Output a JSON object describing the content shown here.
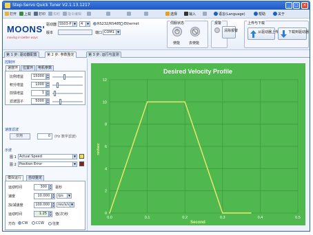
{
  "window": {
    "title": "Step-Servo Quick Tuner V2.1.13.1217"
  },
  "menubar": {
    "items": [
      {
        "label": "打开",
        "icon": "open-icon",
        "color": "#e3b53a"
      },
      {
        "label": "上载",
        "icon": "upload-icon",
        "color": "#3c8a3c"
      },
      {
        "label": "打印",
        "icon": "print-icon",
        "color": "#5a6b8a"
      },
      {
        "label": "实时",
        "icon": "monitor-icon",
        "color": "#6b7d99"
      },
      {
        "label": "指令编辑",
        "icon": "command-editor-icon",
        "color": "#6b7d99"
      },
      {
        "label": "选择",
        "icon": "select-icon",
        "color": "#e6a019"
      },
      {
        "label": "输入",
        "icon": "input-icon",
        "color": "#333333"
      },
      {
        "label": "语言(Language)",
        "icon": "language-icon",
        "color": "#1d5fc4"
      },
      {
        "label": "帮助",
        "icon": "help-icon",
        "color": "#1d5fc4"
      },
      {
        "label": "关于",
        "icon": "about-icon",
        "color": "#1d5fc4"
      }
    ]
  },
  "brand": {
    "logo": "MOONS'",
    "slogan": "moving in better ways"
  },
  "header": {
    "drive_label": "驱动器",
    "drive_model": "SS03-P",
    "drive_suffix": "4",
    "protocol_rs": "RS232/RS485",
    "protocol_eth": "Ethernet",
    "version_label": "版本",
    "port_label": "端口",
    "port_value": "COM1",
    "status_group": "伺服状态",
    "alarm_group": "报警",
    "enable_label": "使能",
    "disable_label": "去使能",
    "clear_alarm_label": "清除报警",
    "transfer_group": "上传与下载",
    "upload_label": "从驱动器上传",
    "download_label": "下载到驱动器"
  },
  "tabs": [
    {
      "label": "第 1 步: 驱动器配置",
      "active": false
    },
    {
      "label": "第 2 步: 参数整定",
      "active": true
    },
    {
      "label": "第 3 步: 运行与监测",
      "active": false
    }
  ],
  "left": {
    "control_section": "控制环",
    "subtabs": [
      "速度环",
      "位置环",
      "电机参数"
    ],
    "params": [
      {
        "label": "比例增益",
        "value": "15000",
        "slider": 0.4
      },
      {
        "label": "积分增益",
        "value": "1000",
        "slider": 0.15
      },
      {
        "label": "前馈增益",
        "value": "1",
        "slider": 0.05
      },
      {
        "label": "滤波因子",
        "value": "5000",
        "slider": 0.25
      }
    ],
    "speed_filter_section": "速度滤波",
    "speed_filter_value": "0",
    "speed_filter_unit": "(Hz 数字滤波)",
    "scope_section": "示波",
    "traces": [
      {
        "label": "图 1",
        "value": "Actual Speed",
        "color": "#f0e04a"
      },
      {
        "label": "图 2",
        "value": "Position Error",
        "color": "#8a1d1d"
      }
    ],
    "motion_tabs": [
      "模拟运行",
      "自动整定"
    ],
    "motion": [
      {
        "label": "运动时间",
        "value": "300",
        "unit": "毫秒"
      },
      {
        "label": "速度",
        "value": "10.000",
        "unit": "rps"
      },
      {
        "label": "加/减速度",
        "value": "100.000",
        "unit": "rev/s/s"
      },
      {
        "label": "运动时间",
        "value": "1.25",
        "unit": "值(次)秒"
      }
    ],
    "direction_label": "方向",
    "dir_cw": "CW",
    "dir_ccw": "CCW",
    "dir_both": "往复"
  },
  "chart_data": {
    "type": "line",
    "title": "Desired Velocity Profile",
    "xlabel": "Second",
    "ylabel": "rev/sec",
    "xlim": [
      0.0,
      0.5
    ],
    "ylim": [
      0,
      12
    ],
    "xticks": [
      "0.0",
      "0.1",
      "0.2",
      "0.3",
      "0.4",
      "0.5"
    ],
    "yticks": [
      "0",
      "2",
      "4",
      "6",
      "8",
      "10",
      "12"
    ],
    "grid": true,
    "background": "#4fb84f",
    "series": [
      {
        "color": "#f2ea6a",
        "x": [
          0.0,
          0.1,
          0.2,
          0.3,
          0.375
        ],
        "y": [
          0,
          10,
          10,
          0,
          0
        ]
      }
    ]
  }
}
